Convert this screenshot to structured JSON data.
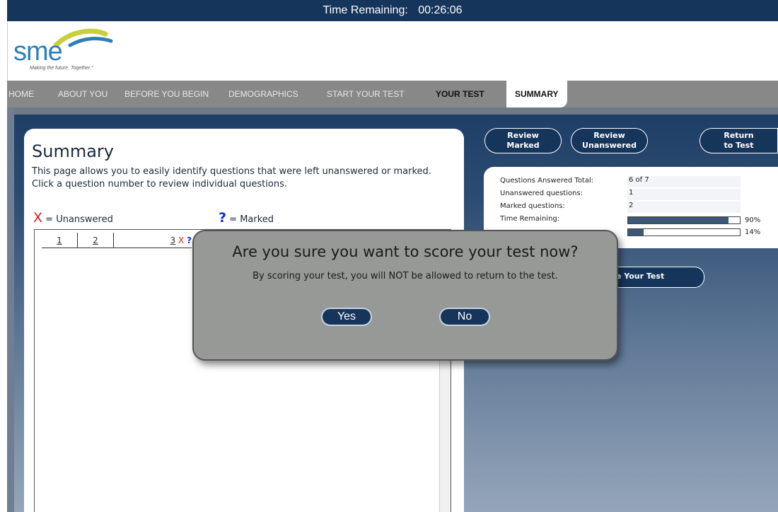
{
  "timer": {
    "label": "Time Remaining:",
    "value": "00:26:06"
  },
  "logo": {
    "name": "sme",
    "tagline": "Making the future. Together.°"
  },
  "nav": {
    "home": "HOME",
    "about": "ABOUT YOU",
    "before": "BEFORE YOU BEGIN",
    "demographics": "DEMOGRAPHICS",
    "start": "START YOUR TEST",
    "your_test": "YOUR TEST",
    "summary": "SUMMARY"
  },
  "summary": {
    "title": "Summary",
    "description": "This page allows you to easily identify questions that were left unanswered or marked. Click a question number to review individual questions.",
    "legend_unanswered_symbol": "X",
    "legend_unanswered": "= Unanswered",
    "legend_marked_symbol": "?",
    "legend_marked": "= Marked",
    "questions": [
      {
        "number": "1",
        "x": "",
        "q": ""
      },
      {
        "number": "2",
        "x": "",
        "q": ""
      },
      {
        "number": "3",
        "x": "X",
        "q": "?"
      }
    ]
  },
  "actions": {
    "review_marked": [
      "Review",
      "Marked"
    ],
    "review_unanswered": [
      "Review",
      "Unanswered"
    ],
    "return_to_test": [
      "Return",
      "to Test"
    ],
    "score_partial": "e Your Test"
  },
  "stats": {
    "answered_label": "Questions Answered Total:",
    "answered_value": "6 of 7",
    "unanswered_label": "Unanswered questions:",
    "unanswered_value": "1",
    "marked_label": "Marked questions:",
    "marked_value": "2",
    "time_label": "Time Remaining:",
    "time_percent": 90,
    "time_percent_text": "90%",
    "second_percent": 14,
    "second_percent_text": "14%"
  },
  "modal": {
    "title": "Are you sure you want to score your test now?",
    "message": "By scoring your test, you will NOT be allowed to return to the test.",
    "yes": "Yes",
    "no": "No"
  },
  "colors": {
    "navy": "#16355b",
    "nav_gray": "#888888",
    "unanswered": "#e0181b",
    "marked": "#1630d0"
  }
}
